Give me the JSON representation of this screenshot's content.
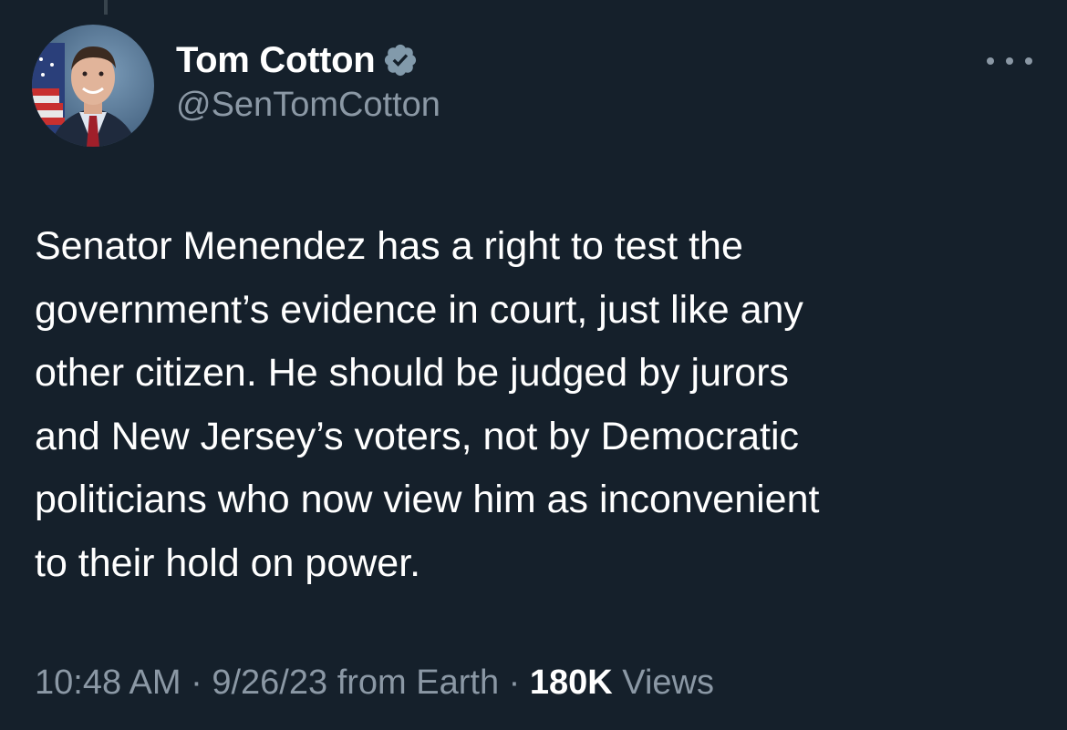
{
  "author": {
    "display_name": "Tom Cotton",
    "handle": "@SenTomCotton",
    "verified_icon": "verified-badge-icon",
    "avatar_icon": "profile-photo"
  },
  "menu_icon": "more-horizontal-icon",
  "tweet": {
    "lines": [
      "Senator Menendez has a right to test the",
      "government’s evidence in court, just like any",
      "other citizen. He should be judged by jurors",
      "and New Jersey’s voters, not by Democratic",
      "politicians who now view him as inconvenient",
      "to their hold on power."
    ]
  },
  "meta": {
    "time": "10:48 AM",
    "separator": "·",
    "date": "9/26/23",
    "source": "from Earth",
    "views_count": "180K",
    "views_label": "Views"
  },
  "colors": {
    "background": "#15202b",
    "text": "#ffffff",
    "secondary": "#8b98a5",
    "verified": "#829aab"
  }
}
